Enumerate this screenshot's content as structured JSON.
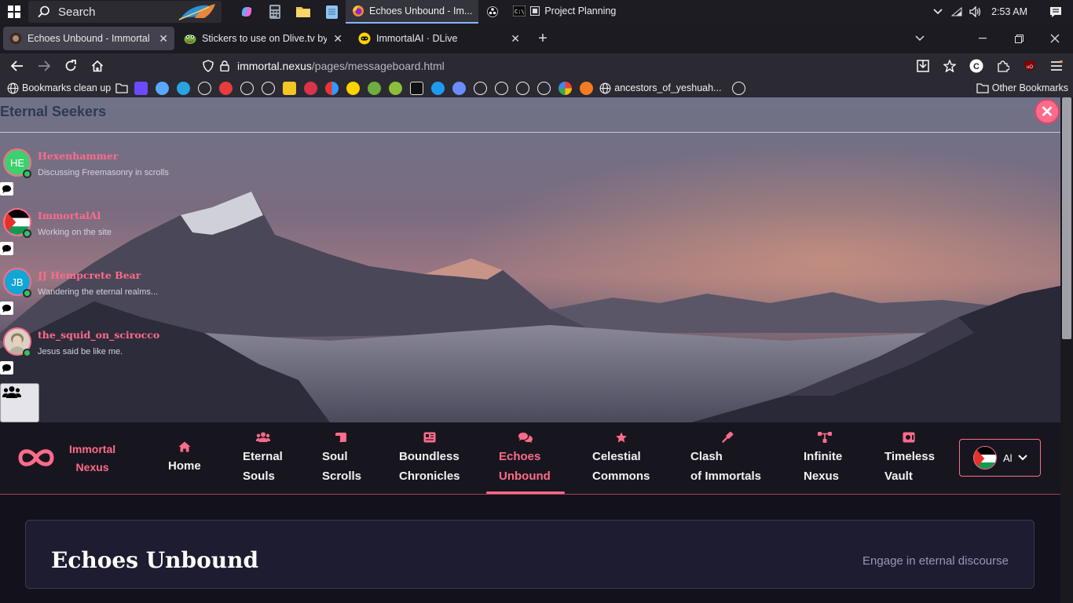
{
  "taskbar": {
    "search_placeholder": "Search",
    "apps": [
      {
        "label": "Echoes Unbound - Im...",
        "active": true
      },
      {
        "label": "Project Planning",
        "active": false
      }
    ],
    "clock": "2:53 AM"
  },
  "browser": {
    "tabs": [
      {
        "title": "Echoes Unbound - Immortal Nexus",
        "active": true
      },
      {
        "title": "Stickers to use on Dlive.tv by sp",
        "active": false
      },
      {
        "title": "ImmortalAI · DLive",
        "active": false
      }
    ],
    "url_domain": "immortal.nexus",
    "url_path": "/pages/messageboard.html",
    "bookmarks": {
      "first": "Bookmarks clean up",
      "named": "ancestors_of_yeshuah...",
      "other": "Other Bookmarks"
    }
  },
  "panel": {
    "title": "Eternal Seekers",
    "close_label": "✕",
    "users": [
      {
        "name": "Hexenhammer",
        "status": "Discussing Freemasonry in scrolls",
        "initials": "HE",
        "avatar_color": "#3ecf6e"
      },
      {
        "name": "ImmortalAl",
        "status": "Working on the site",
        "initials": "",
        "avatar_color": "#ffffff"
      },
      {
        "name": "JJ Hempcrete Bear",
        "status": "Wandering the eternal realms...",
        "initials": "JB",
        "avatar_color": "#12a6d6"
      },
      {
        "name": "the_squid_on_scirocco",
        "status": "Jesus said be like me.",
        "initials": "",
        "avatar_color": "#c9c3b4"
      }
    ]
  },
  "site": {
    "brand_line1": "Immortal",
    "brand_line2": "Nexus",
    "nav": [
      {
        "line1": "Home",
        "line2": "",
        "icon": "home-icon"
      },
      {
        "line1": "Eternal",
        "line2": "Souls",
        "icon": "users-icon"
      },
      {
        "line1": "Soul",
        "line2": "Scrolls",
        "icon": "scroll-icon"
      },
      {
        "line1": "Boundless",
        "line2": "Chronicles",
        "icon": "newspaper-icon"
      },
      {
        "line1": "Echoes",
        "line2": "Unbound",
        "icon": "comments-icon",
        "active": true
      },
      {
        "line1": "Celestial",
        "line2": "Commons",
        "icon": "star-icon"
      },
      {
        "line1": "Clash",
        "line2": "of Immortals",
        "icon": "gavel-icon"
      },
      {
        "line1": "Infinite",
        "line2": "Nexus",
        "icon": "network-icon"
      },
      {
        "line1": "Timeless",
        "line2": "Vault",
        "icon": "vault-icon"
      }
    ],
    "user_menu_label": "Al"
  },
  "page_header": {
    "title": "Echoes Unbound",
    "subtitle": "Engage in eternal discourse"
  },
  "colors": {
    "accent": "#ff6b8a",
    "online": "#37c25a",
    "taskbar": "#1c1c22",
    "toolbar": "#2b2a33"
  }
}
